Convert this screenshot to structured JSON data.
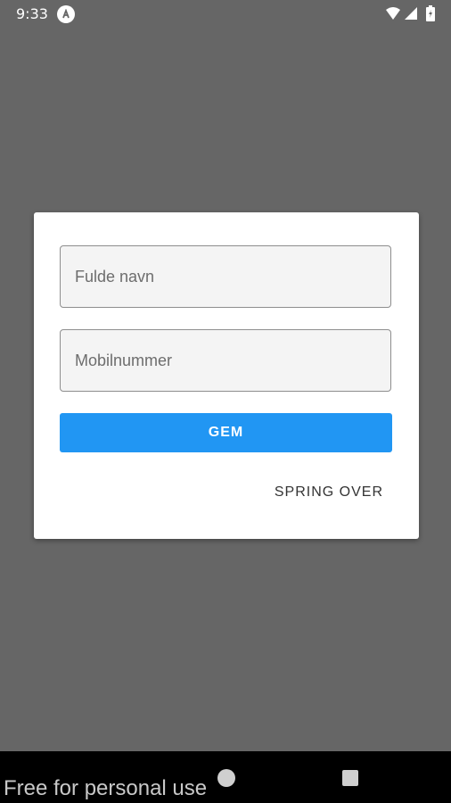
{
  "status_bar": {
    "time": "9:33",
    "icons": [
      "app-a-icon",
      "wifi-icon",
      "signal-icon",
      "battery-icon"
    ]
  },
  "dialog": {
    "name_field": {
      "value": "",
      "placeholder": "Fulde navn"
    },
    "phone_field": {
      "value": "",
      "placeholder": "Mobilnummer"
    },
    "save_label": "GEM",
    "skip_label": "SPRING OVER"
  },
  "nav_bar": {
    "icons": [
      "home-icon",
      "recents-icon"
    ]
  },
  "watermark": "Free for personal use",
  "colors": {
    "scrim": "#666666",
    "dialog_background": "#ffffff",
    "primary": "#2196f3",
    "field_background": "#f4f4f4",
    "nav_background": "#000000"
  }
}
